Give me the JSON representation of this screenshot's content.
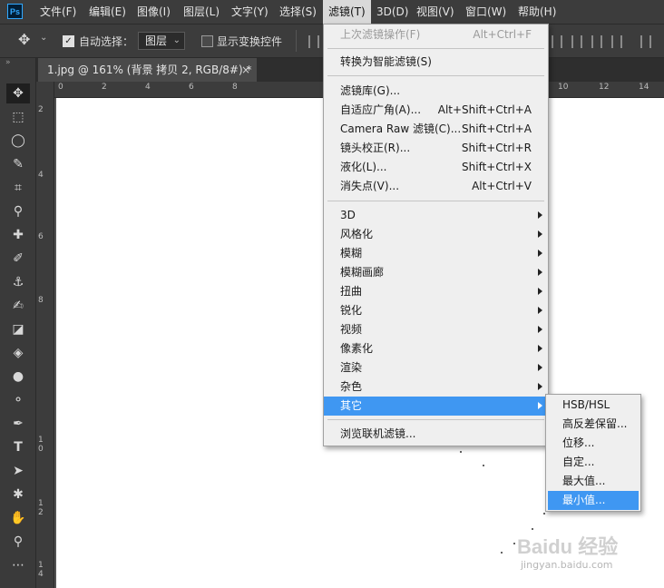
{
  "app": {
    "logo": "Ps"
  },
  "menubar": {
    "items": [
      {
        "label": "文件(F)"
      },
      {
        "label": "编辑(E)"
      },
      {
        "label": "图像(I)"
      },
      {
        "label": "图层(L)"
      },
      {
        "label": "文字(Y)"
      },
      {
        "label": "选择(S)"
      },
      {
        "label": "滤镜(T)"
      },
      {
        "label": "3D(D)"
      },
      {
        "label": "视图(V)"
      },
      {
        "label": "窗口(W)"
      },
      {
        "label": "帮助(H)"
      }
    ],
    "active": "滤镜(T)"
  },
  "options": {
    "auto_select_label": "自动选择：",
    "auto_select_checked": true,
    "layer_select_value": "图层",
    "show_transform_label": "显示变换控件",
    "show_transform_checked": false
  },
  "document": {
    "tab_title": "1.jpg @ 161% (背景 拷贝 2, RGB/8#) *",
    "close_glyph": "×"
  },
  "rulers": {
    "top": [
      "0",
      "2",
      "4",
      "6",
      "8",
      "10",
      "12",
      "14"
    ],
    "left": [
      "2",
      "4",
      "6",
      "8",
      "10",
      "12",
      "14"
    ]
  },
  "filter_menu": {
    "last_filter": {
      "label": "上次滤镜操作(F)",
      "shortcut": "Alt+Ctrl+F",
      "disabled": true
    },
    "smart": {
      "label": "转换为智能滤镜(S)"
    },
    "group1": [
      {
        "label": "滤镜库(G)...",
        "shortcut": ""
      },
      {
        "label": "自适应广角(A)...",
        "shortcut": "Alt+Shift+Ctrl+A"
      },
      {
        "label": "Camera Raw 滤镜(C)...",
        "shortcut": "Shift+Ctrl+A"
      },
      {
        "label": "镜头校正(R)...",
        "shortcut": "Shift+Ctrl+R"
      },
      {
        "label": "液化(L)...",
        "shortcut": "Shift+Ctrl+X"
      },
      {
        "label": "消失点(V)...",
        "shortcut": "Alt+Ctrl+V"
      }
    ],
    "group2": [
      {
        "label": "3D"
      },
      {
        "label": "风格化"
      },
      {
        "label": "模糊"
      },
      {
        "label": "模糊画廊"
      },
      {
        "label": "扭曲"
      },
      {
        "label": "锐化"
      },
      {
        "label": "视频"
      },
      {
        "label": "像素化"
      },
      {
        "label": "渲染"
      },
      {
        "label": "杂色"
      },
      {
        "label": "其它"
      }
    ],
    "highlighted": "其它",
    "online": {
      "label": "浏览联机滤镜..."
    }
  },
  "submenu": {
    "items": [
      {
        "label": "HSB/HSL"
      },
      {
        "label": "高反差保留..."
      },
      {
        "label": "位移..."
      },
      {
        "label": "自定..."
      },
      {
        "label": "最大值..."
      },
      {
        "label": "最小值..."
      }
    ],
    "highlighted": "最小值..."
  },
  "watermark": {
    "text": "Baidu 经验",
    "sub": "jingyan.baidu.com"
  },
  "colors": {
    "highlight": "#3f97f2",
    "menu_bg": "#efefef",
    "chrome": "#3c3c3c"
  }
}
